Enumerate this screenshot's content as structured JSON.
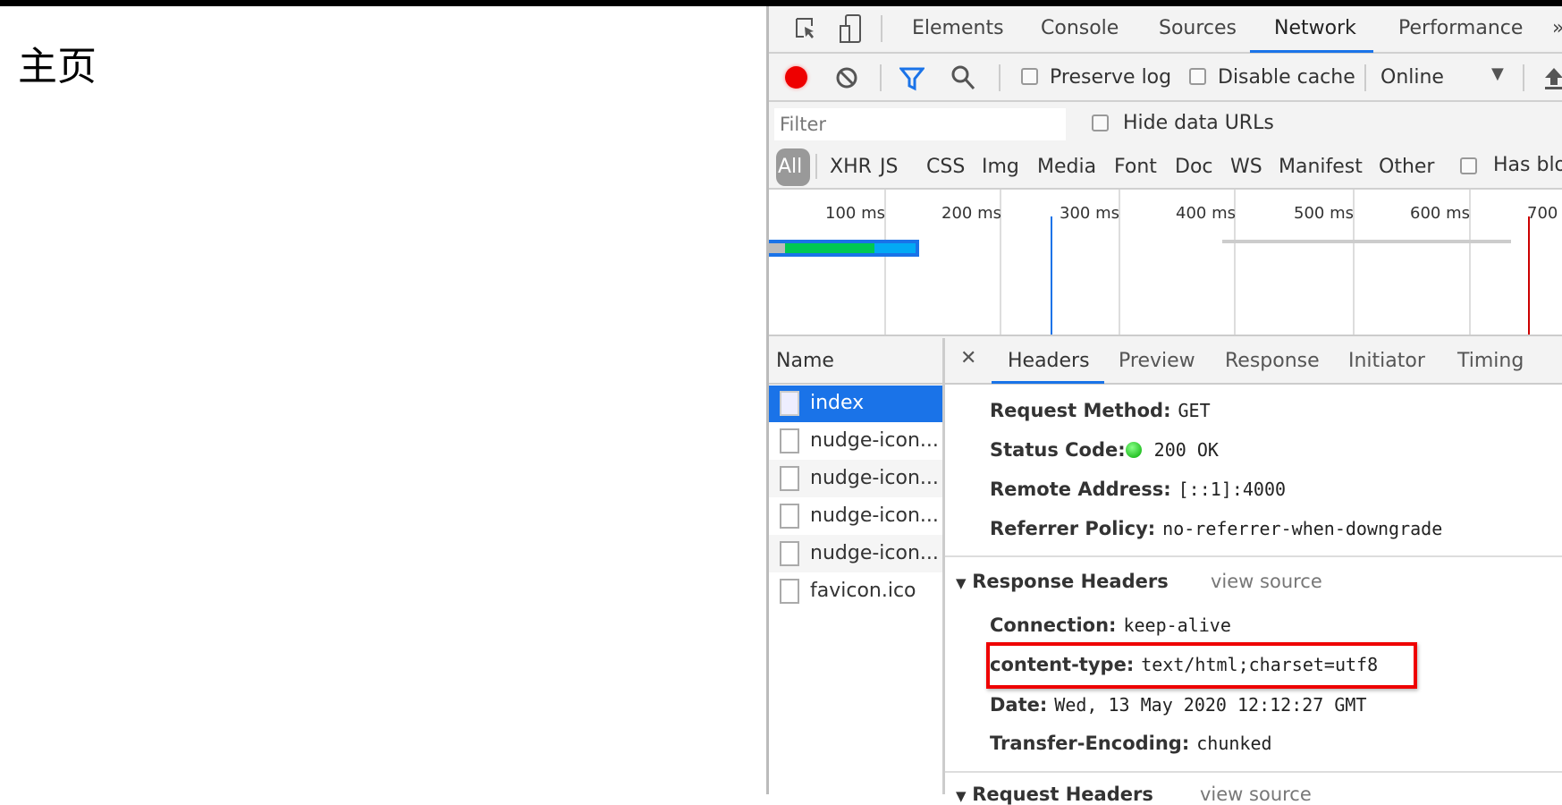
{
  "page": {
    "title": "主页"
  },
  "devtools": {
    "tabs": [
      "Elements",
      "Console",
      "Sources",
      "Network",
      "Performance"
    ],
    "active_tab": "Network",
    "toolbar": {
      "preserve_log": "Preserve log",
      "disable_cache": "Disable cache",
      "throttle": "Online"
    },
    "filter": {
      "placeholder": "Filter",
      "hide_data_urls": "Hide data URLs"
    },
    "types": [
      "All",
      "XHR",
      "JS",
      "CSS",
      "Img",
      "Media",
      "Font",
      "Doc",
      "WS",
      "Manifest",
      "Other"
    ],
    "has_blocked": "Has blo",
    "timeline": {
      "ticks": [
        "100 ms",
        "200 ms",
        "300 ms",
        "400 ms",
        "500 ms",
        "600 ms",
        "700"
      ]
    },
    "name_header": "Name",
    "requests": [
      "index",
      "nudge-icon...",
      "nudge-icon...",
      "nudge-icon...",
      "nudge-icon...",
      "favicon.ico"
    ],
    "detail_tabs": [
      "Headers",
      "Preview",
      "Response",
      "Initiator",
      "Timing"
    ],
    "general": [
      {
        "k": "Request Method:",
        "v": "GET"
      },
      {
        "k": "Status Code:",
        "v": "200 OK"
      },
      {
        "k": "Remote Address:",
        "v": "[::1]:4000"
      },
      {
        "k": "Referrer Policy:",
        "v": "no-referrer-when-downgrade"
      }
    ],
    "response_headers": {
      "title": "Response Headers",
      "view_source": "view source",
      "items": [
        {
          "k": "Connection:",
          "v": "keep-alive"
        },
        {
          "k": "content-type:",
          "v": "text/html;charset=utf8"
        },
        {
          "k": "Date:",
          "v": "Wed, 13 May 2020 12:12:27 GMT"
        },
        {
          "k": "Transfer-Encoding:",
          "v": "chunked"
        }
      ]
    },
    "request_headers": {
      "title": "Request Headers",
      "view_source": "view source"
    }
  }
}
